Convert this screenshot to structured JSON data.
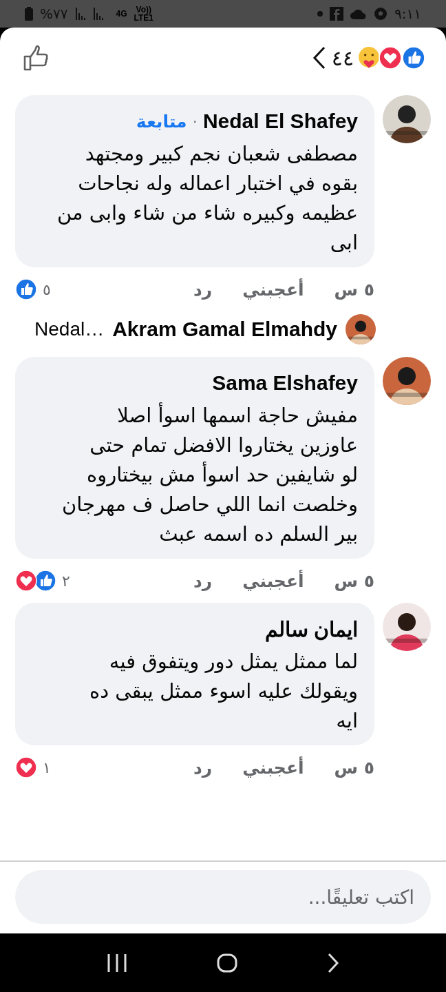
{
  "status_bar": {
    "battery": "%٧٧",
    "network": "4G",
    "carrier": "Vo))\nLTE1",
    "time": "٩:١١"
  },
  "header": {
    "reactions": [
      {
        "kind": "like"
      },
      {
        "kind": "love"
      },
      {
        "kind": "care"
      }
    ],
    "count": "٤٤"
  },
  "comments": [
    {
      "author": "Nedal El Shafey",
      "separator": "·",
      "follow": "متابعة",
      "text": "مصطفى شعبان نجم كبير ومجتهد\nبقوه في اختبار اعماله وله نجاحات\nعظيمه وكبيره شاء من شاء وابى من\nابى",
      "time": "٥ س",
      "like": "أعجبني",
      "reply": "رد",
      "reactions": [
        {
          "kind": "like"
        }
      ],
      "reaction_count": "٥",
      "reply_preview": {
        "author": "Akram Gamal Elmahdy",
        "snippet": "Nedal…"
      }
    },
    {
      "author": "Sama Elshafey",
      "text": "مفيش حاجة اسمها اسوأ اصلا\nعاوزين يختاروا الافضل تمام حتى\nلو شايفين حد اسوأ مش بيختاروه\nوخلصت انما اللي حاصل ف مهرجان\nبير السلم ده اسمه عبث",
      "time": "٥ س",
      "like": "أعجبني",
      "reply": "رد",
      "reactions": [
        {
          "kind": "love"
        },
        {
          "kind": "like"
        }
      ],
      "reaction_count": "٢"
    },
    {
      "author": "ايمان سالم",
      "text": "لما ممثل يمثل دور ويتفوق فيه\nويقولك عليه اسوء ممثل يبقى ده\nايه",
      "time": "٥ س",
      "like": "أعجبني",
      "reply": "رد",
      "reactions": [
        {
          "kind": "love"
        }
      ],
      "reaction_count": "١"
    }
  ],
  "composer": {
    "placeholder": "اكتب تعليقًا..."
  }
}
